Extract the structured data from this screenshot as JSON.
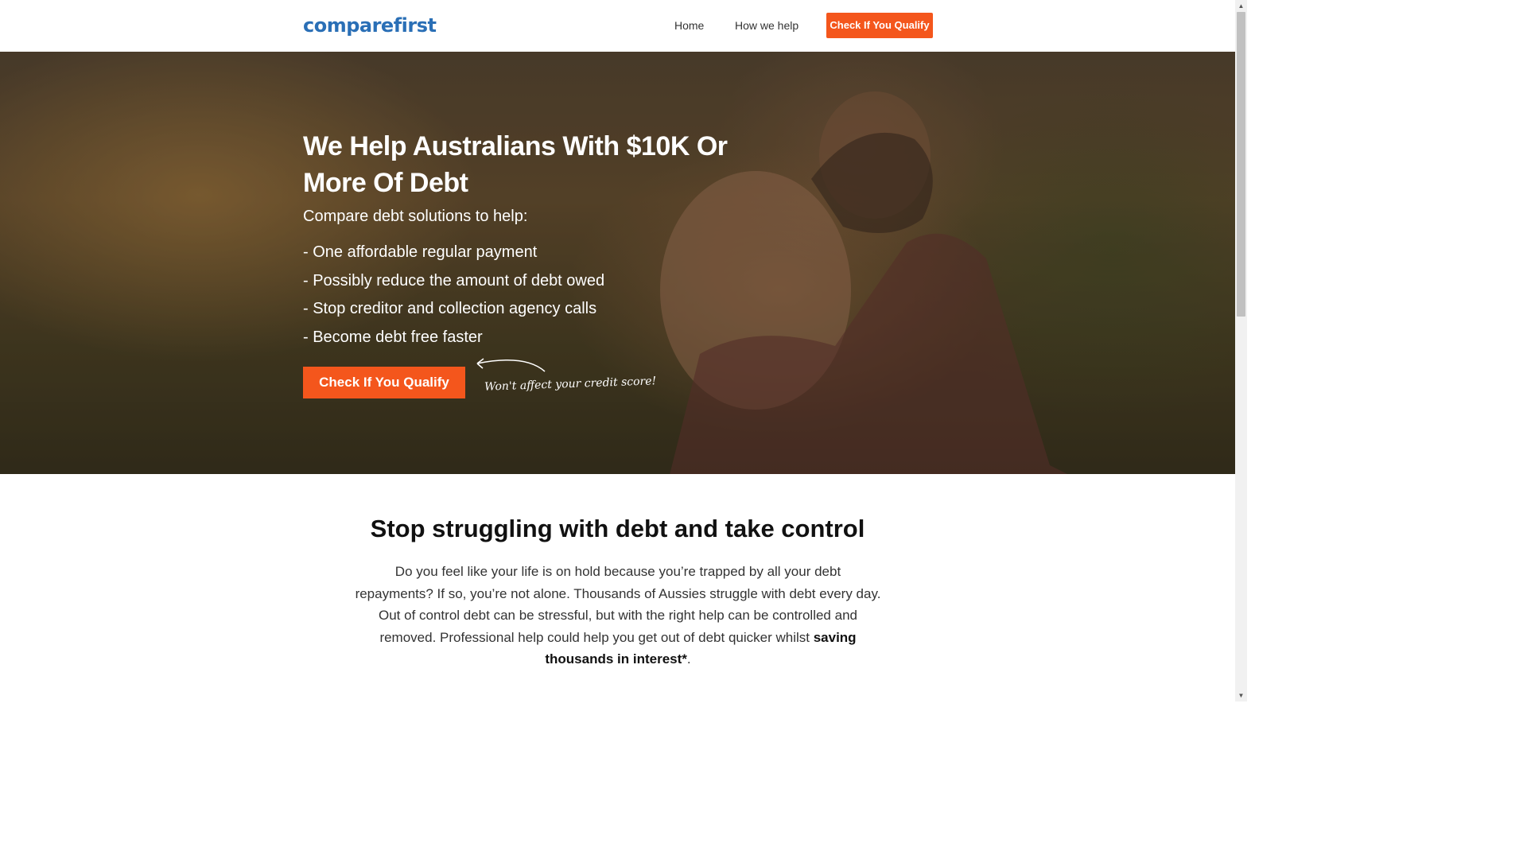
{
  "header": {
    "logo": "comparefirst",
    "nav": {
      "home": "Home",
      "how_we_help": "How we help",
      "cta": "Check If You Qualify"
    }
  },
  "hero": {
    "title": "We Help Australians With $10K Or More Of Debt",
    "subtitle": "Compare debt solutions to help:",
    "bullets": [
      "- One affordable regular payment",
      "- Possibly reduce the amount of debt owed",
      "- Stop creditor and collection agency calls",
      "- Become debt free faster"
    ],
    "cta": "Check If You Qualify",
    "note": "Won't affect your credit score!"
  },
  "section": {
    "title": "Stop struggling with debt and take control",
    "body": "Do you feel like your life is on hold because you’re trapped by all your debt repayments? If so, you’re not alone. Thousands of Aussies struggle with debt every day. Out of control debt can be stressful, but with the right help can be controlled and removed. Professional help could help you get out of debt quicker whilst ",
    "body_bold": "saving thousands in interest*",
    "body_end": "."
  },
  "colors": {
    "brand_blue": "#2a6fb6",
    "accent_orange": "#f4561c"
  },
  "icons": {
    "scroll_up": "scroll-up-arrow-icon",
    "scroll_down": "scroll-down-arrow-icon",
    "hero_arrow": "curved-arrow-icon"
  }
}
